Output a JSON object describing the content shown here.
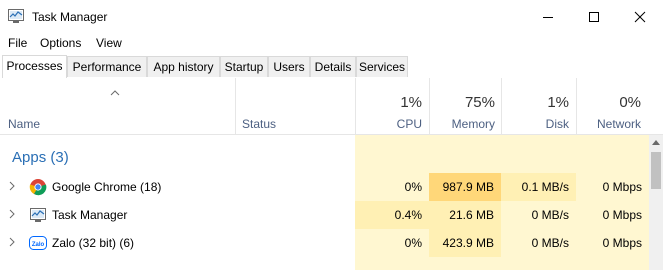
{
  "window": {
    "title": "Task Manager"
  },
  "menu": [
    "File",
    "Options",
    "View"
  ],
  "tabs": [
    "Processes",
    "Performance",
    "App history",
    "Startup",
    "Users",
    "Details",
    "Services"
  ],
  "header": {
    "name": "Name",
    "status": "Status",
    "cpu": {
      "pct": "1%",
      "label": "CPU"
    },
    "memory": {
      "pct": "75%",
      "label": "Memory"
    },
    "disk": {
      "pct": "1%",
      "label": "Disk"
    },
    "network": {
      "pct": "0%",
      "label": "Network"
    }
  },
  "group": {
    "title": "Apps (3)"
  },
  "processes": [
    {
      "name": "Google Chrome (18)",
      "icon": "chrome-icon",
      "cpu": "0%",
      "memory": "987.9 MB",
      "disk": "0.1 MB/s",
      "network": "0 Mbps"
    },
    {
      "name": "Task Manager",
      "icon": "task-manager-icon",
      "cpu": "0.4%",
      "memory": "21.6 MB",
      "disk": "0 MB/s",
      "network": "0 Mbps"
    },
    {
      "name": "Zalo (32 bit) (6)",
      "icon": "zalo-icon",
      "cpu": "0%",
      "memory": "423.9 MB",
      "disk": "0 MB/s",
      "network": "0 Mbps"
    }
  ],
  "icons": {
    "zalo_text": "Zalo"
  },
  "colors": {
    "heat_light": "#fff7d1",
    "heat_medium": "#fff0b4",
    "heat_high": "#ffd779",
    "header_text": "#4d6082",
    "group_title": "#2a6fb5"
  }
}
